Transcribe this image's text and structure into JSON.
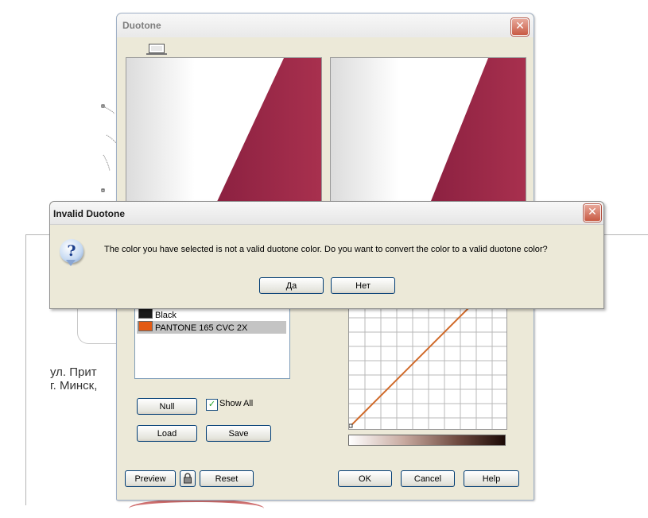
{
  "background": {
    "address_line1": "ул. Прит",
    "address_line2": "г. Минск,"
  },
  "duotone_dialog": {
    "title": "Duotone",
    "close_glyph": "✕",
    "inks": [
      {
        "label": "Black",
        "color": "#1a1a1a",
        "selected": false
      },
      {
        "label": "PANTONE 165 CVC 2X",
        "color": "#e35a14",
        "selected": true
      }
    ],
    "null_label": "Null",
    "show_all_label": "Show All",
    "show_all_checked": true,
    "check_glyph": "✓",
    "load_label": "Load",
    "save_label": "Save",
    "preview_label": "Preview",
    "reset_label": "Reset",
    "ok_label": "OK",
    "cancel_label": "Cancel",
    "help_label": "Help",
    "preview_color": "#9a2a45",
    "curve_color": "#d06a2a"
  },
  "invalid_dialog": {
    "title": "Invalid Duotone",
    "close_glyph": "✕",
    "icon_glyph": "?",
    "message": "The color you have selected is not a valid duotone color.  Do you want to convert the color to a valid duotone color?",
    "yes_label": "Да",
    "no_label": "Нет"
  }
}
